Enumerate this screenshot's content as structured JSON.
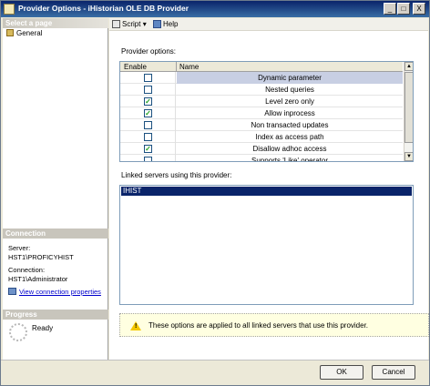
{
  "window": {
    "title": "Provider Options - iHistorian OLE DB Provider",
    "minimize_glyph": "_",
    "maximize_glyph": "□",
    "close_glyph": "X"
  },
  "left": {
    "select_page_header": "Select a page",
    "pages": [
      {
        "label": "General",
        "icon": "page-icon"
      }
    ],
    "connection_header": "Connection",
    "server_label": "Server:",
    "server_value": "HST1\\PROFICYHIST",
    "connection_label": "Connection:",
    "connection_value": "HST1\\Administrator",
    "view_connection_link": "View connection properties",
    "progress_header": "Progress",
    "progress_status": "Ready"
  },
  "toolbar": {
    "script_label": "Script",
    "script_dropdown_glyph": "▾",
    "help_label": "Help"
  },
  "provider": {
    "label": "Provider options:",
    "col_enable": "Enable",
    "col_name": "Name",
    "rows": [
      {
        "name": "Dynamic parameter",
        "checked": false,
        "check_glyph": ""
      },
      {
        "name": "Nested queries",
        "checked": false,
        "check_glyph": ""
      },
      {
        "name": "Level zero only",
        "checked": true,
        "check_glyph": "✓"
      },
      {
        "name": "Allow inprocess",
        "checked": true,
        "check_glyph": "✓"
      },
      {
        "name": "Non transacted updates",
        "checked": false,
        "check_glyph": ""
      },
      {
        "name": "Index as access path",
        "checked": false,
        "check_glyph": ""
      },
      {
        "name": "Disallow adhoc access",
        "checked": true,
        "check_glyph": "✓"
      },
      {
        "name": "Supports 'Like' operator",
        "checked": false,
        "check_glyph": ""
      }
    ],
    "scroll_up_glyph": "▲",
    "scroll_down_glyph": "▼"
  },
  "linked": {
    "label": "Linked servers using this provider:",
    "items": [
      "IHIST"
    ]
  },
  "info": {
    "warning_glyph": "!",
    "text": "These options are applied to all linked servers that use this provider."
  },
  "buttons": {
    "ok": "OK",
    "cancel": "Cancel"
  },
  "colors": {
    "titlebar": "#0a246a",
    "selection": "#0a246a",
    "link": "#0000cc",
    "info_background": "#ffffe1"
  }
}
